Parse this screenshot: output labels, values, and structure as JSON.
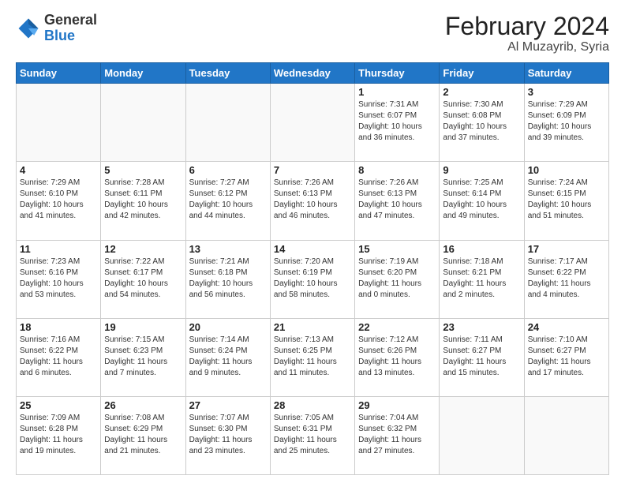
{
  "header": {
    "logo_general": "General",
    "logo_blue": "Blue",
    "title": "February 2024",
    "subtitle": "Al Muzayrib, Syria"
  },
  "weekdays": [
    "Sunday",
    "Monday",
    "Tuesday",
    "Wednesday",
    "Thursday",
    "Friday",
    "Saturday"
  ],
  "weeks": [
    [
      {
        "day": "",
        "sunrise": "",
        "sunset": "",
        "daylight": ""
      },
      {
        "day": "",
        "sunrise": "",
        "sunset": "",
        "daylight": ""
      },
      {
        "day": "",
        "sunrise": "",
        "sunset": "",
        "daylight": ""
      },
      {
        "day": "",
        "sunrise": "",
        "sunset": "",
        "daylight": ""
      },
      {
        "day": "1",
        "sunrise": "Sunrise: 7:31 AM",
        "sunset": "Sunset: 6:07 PM",
        "daylight": "Daylight: 10 hours and 36 minutes."
      },
      {
        "day": "2",
        "sunrise": "Sunrise: 7:30 AM",
        "sunset": "Sunset: 6:08 PM",
        "daylight": "Daylight: 10 hours and 37 minutes."
      },
      {
        "day": "3",
        "sunrise": "Sunrise: 7:29 AM",
        "sunset": "Sunset: 6:09 PM",
        "daylight": "Daylight: 10 hours and 39 minutes."
      }
    ],
    [
      {
        "day": "4",
        "sunrise": "Sunrise: 7:29 AM",
        "sunset": "Sunset: 6:10 PM",
        "daylight": "Daylight: 10 hours and 41 minutes."
      },
      {
        "day": "5",
        "sunrise": "Sunrise: 7:28 AM",
        "sunset": "Sunset: 6:11 PM",
        "daylight": "Daylight: 10 hours and 42 minutes."
      },
      {
        "day": "6",
        "sunrise": "Sunrise: 7:27 AM",
        "sunset": "Sunset: 6:12 PM",
        "daylight": "Daylight: 10 hours and 44 minutes."
      },
      {
        "day": "7",
        "sunrise": "Sunrise: 7:26 AM",
        "sunset": "Sunset: 6:13 PM",
        "daylight": "Daylight: 10 hours and 46 minutes."
      },
      {
        "day": "8",
        "sunrise": "Sunrise: 7:26 AM",
        "sunset": "Sunset: 6:13 PM",
        "daylight": "Daylight: 10 hours and 47 minutes."
      },
      {
        "day": "9",
        "sunrise": "Sunrise: 7:25 AM",
        "sunset": "Sunset: 6:14 PM",
        "daylight": "Daylight: 10 hours and 49 minutes."
      },
      {
        "day": "10",
        "sunrise": "Sunrise: 7:24 AM",
        "sunset": "Sunset: 6:15 PM",
        "daylight": "Daylight: 10 hours and 51 minutes."
      }
    ],
    [
      {
        "day": "11",
        "sunrise": "Sunrise: 7:23 AM",
        "sunset": "Sunset: 6:16 PM",
        "daylight": "Daylight: 10 hours and 53 minutes."
      },
      {
        "day": "12",
        "sunrise": "Sunrise: 7:22 AM",
        "sunset": "Sunset: 6:17 PM",
        "daylight": "Daylight: 10 hours and 54 minutes."
      },
      {
        "day": "13",
        "sunrise": "Sunrise: 7:21 AM",
        "sunset": "Sunset: 6:18 PM",
        "daylight": "Daylight: 10 hours and 56 minutes."
      },
      {
        "day": "14",
        "sunrise": "Sunrise: 7:20 AM",
        "sunset": "Sunset: 6:19 PM",
        "daylight": "Daylight: 10 hours and 58 minutes."
      },
      {
        "day": "15",
        "sunrise": "Sunrise: 7:19 AM",
        "sunset": "Sunset: 6:20 PM",
        "daylight": "Daylight: 11 hours and 0 minutes."
      },
      {
        "day": "16",
        "sunrise": "Sunrise: 7:18 AM",
        "sunset": "Sunset: 6:21 PM",
        "daylight": "Daylight: 11 hours and 2 minutes."
      },
      {
        "day": "17",
        "sunrise": "Sunrise: 7:17 AM",
        "sunset": "Sunset: 6:22 PM",
        "daylight": "Daylight: 11 hours and 4 minutes."
      }
    ],
    [
      {
        "day": "18",
        "sunrise": "Sunrise: 7:16 AM",
        "sunset": "Sunset: 6:22 PM",
        "daylight": "Daylight: 11 hours and 6 minutes."
      },
      {
        "day": "19",
        "sunrise": "Sunrise: 7:15 AM",
        "sunset": "Sunset: 6:23 PM",
        "daylight": "Daylight: 11 hours and 7 minutes."
      },
      {
        "day": "20",
        "sunrise": "Sunrise: 7:14 AM",
        "sunset": "Sunset: 6:24 PM",
        "daylight": "Daylight: 11 hours and 9 minutes."
      },
      {
        "day": "21",
        "sunrise": "Sunrise: 7:13 AM",
        "sunset": "Sunset: 6:25 PM",
        "daylight": "Daylight: 11 hours and 11 minutes."
      },
      {
        "day": "22",
        "sunrise": "Sunrise: 7:12 AM",
        "sunset": "Sunset: 6:26 PM",
        "daylight": "Daylight: 11 hours and 13 minutes."
      },
      {
        "day": "23",
        "sunrise": "Sunrise: 7:11 AM",
        "sunset": "Sunset: 6:27 PM",
        "daylight": "Daylight: 11 hours and 15 minutes."
      },
      {
        "day": "24",
        "sunrise": "Sunrise: 7:10 AM",
        "sunset": "Sunset: 6:27 PM",
        "daylight": "Daylight: 11 hours and 17 minutes."
      }
    ],
    [
      {
        "day": "25",
        "sunrise": "Sunrise: 7:09 AM",
        "sunset": "Sunset: 6:28 PM",
        "daylight": "Daylight: 11 hours and 19 minutes."
      },
      {
        "day": "26",
        "sunrise": "Sunrise: 7:08 AM",
        "sunset": "Sunset: 6:29 PM",
        "daylight": "Daylight: 11 hours and 21 minutes."
      },
      {
        "day": "27",
        "sunrise": "Sunrise: 7:07 AM",
        "sunset": "Sunset: 6:30 PM",
        "daylight": "Daylight: 11 hours and 23 minutes."
      },
      {
        "day": "28",
        "sunrise": "Sunrise: 7:05 AM",
        "sunset": "Sunset: 6:31 PM",
        "daylight": "Daylight: 11 hours and 25 minutes."
      },
      {
        "day": "29",
        "sunrise": "Sunrise: 7:04 AM",
        "sunset": "Sunset: 6:32 PM",
        "daylight": "Daylight: 11 hours and 27 minutes."
      },
      {
        "day": "",
        "sunrise": "",
        "sunset": "",
        "daylight": ""
      },
      {
        "day": "",
        "sunrise": "",
        "sunset": "",
        "daylight": ""
      }
    ]
  ]
}
